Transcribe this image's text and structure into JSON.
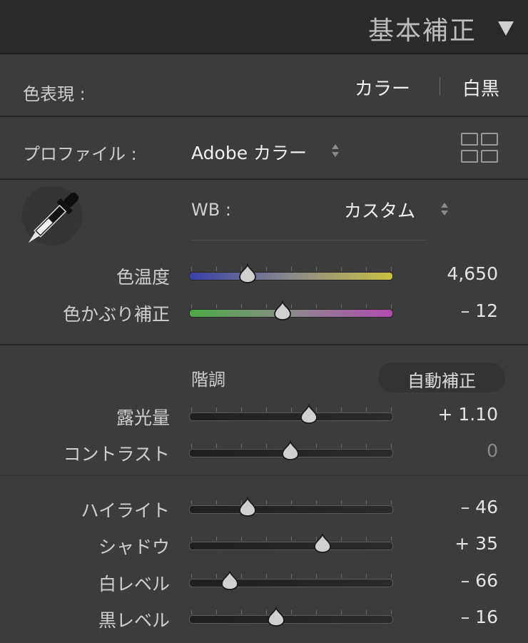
{
  "header": {
    "title": "基本補正",
    "toggle_icon": "triangle-down-icon"
  },
  "treatment": {
    "label": "色表現 :",
    "color_label": "カラー",
    "bw_label": "白黒"
  },
  "profile": {
    "label": "プロファイル :",
    "value": "Adobe カラー",
    "browser_icon": "grid-icon"
  },
  "wb": {
    "eyedropper_icon": "eyedropper-icon",
    "label": "WB :",
    "value": "カスタム",
    "sliders": [
      {
        "label": "色温度",
        "value": "4,650",
        "position": 0.29,
        "style": "temp"
      },
      {
        "label": "色かぶり補正",
        "value": "– 12",
        "position": 0.46,
        "style": "tint"
      }
    ]
  },
  "tone": {
    "label": "階調",
    "auto_label": "自動補正",
    "sliders": [
      {
        "label": "露光量",
        "value": "+ 1.10",
        "position": 0.59,
        "muted": false
      },
      {
        "label": "コントラスト",
        "value": "0",
        "position": 0.5,
        "muted": true
      }
    ]
  },
  "presence": {
    "sliders": [
      {
        "label": "ハイライト",
        "value": "– 46",
        "position": 0.29
      },
      {
        "label": "シャドウ",
        "value": "+ 35",
        "position": 0.66
      },
      {
        "label": "白レベル",
        "value": "– 66",
        "position": 0.2
      },
      {
        "label": "黒レベル",
        "value": "– 16",
        "position": 0.43
      }
    ]
  }
}
